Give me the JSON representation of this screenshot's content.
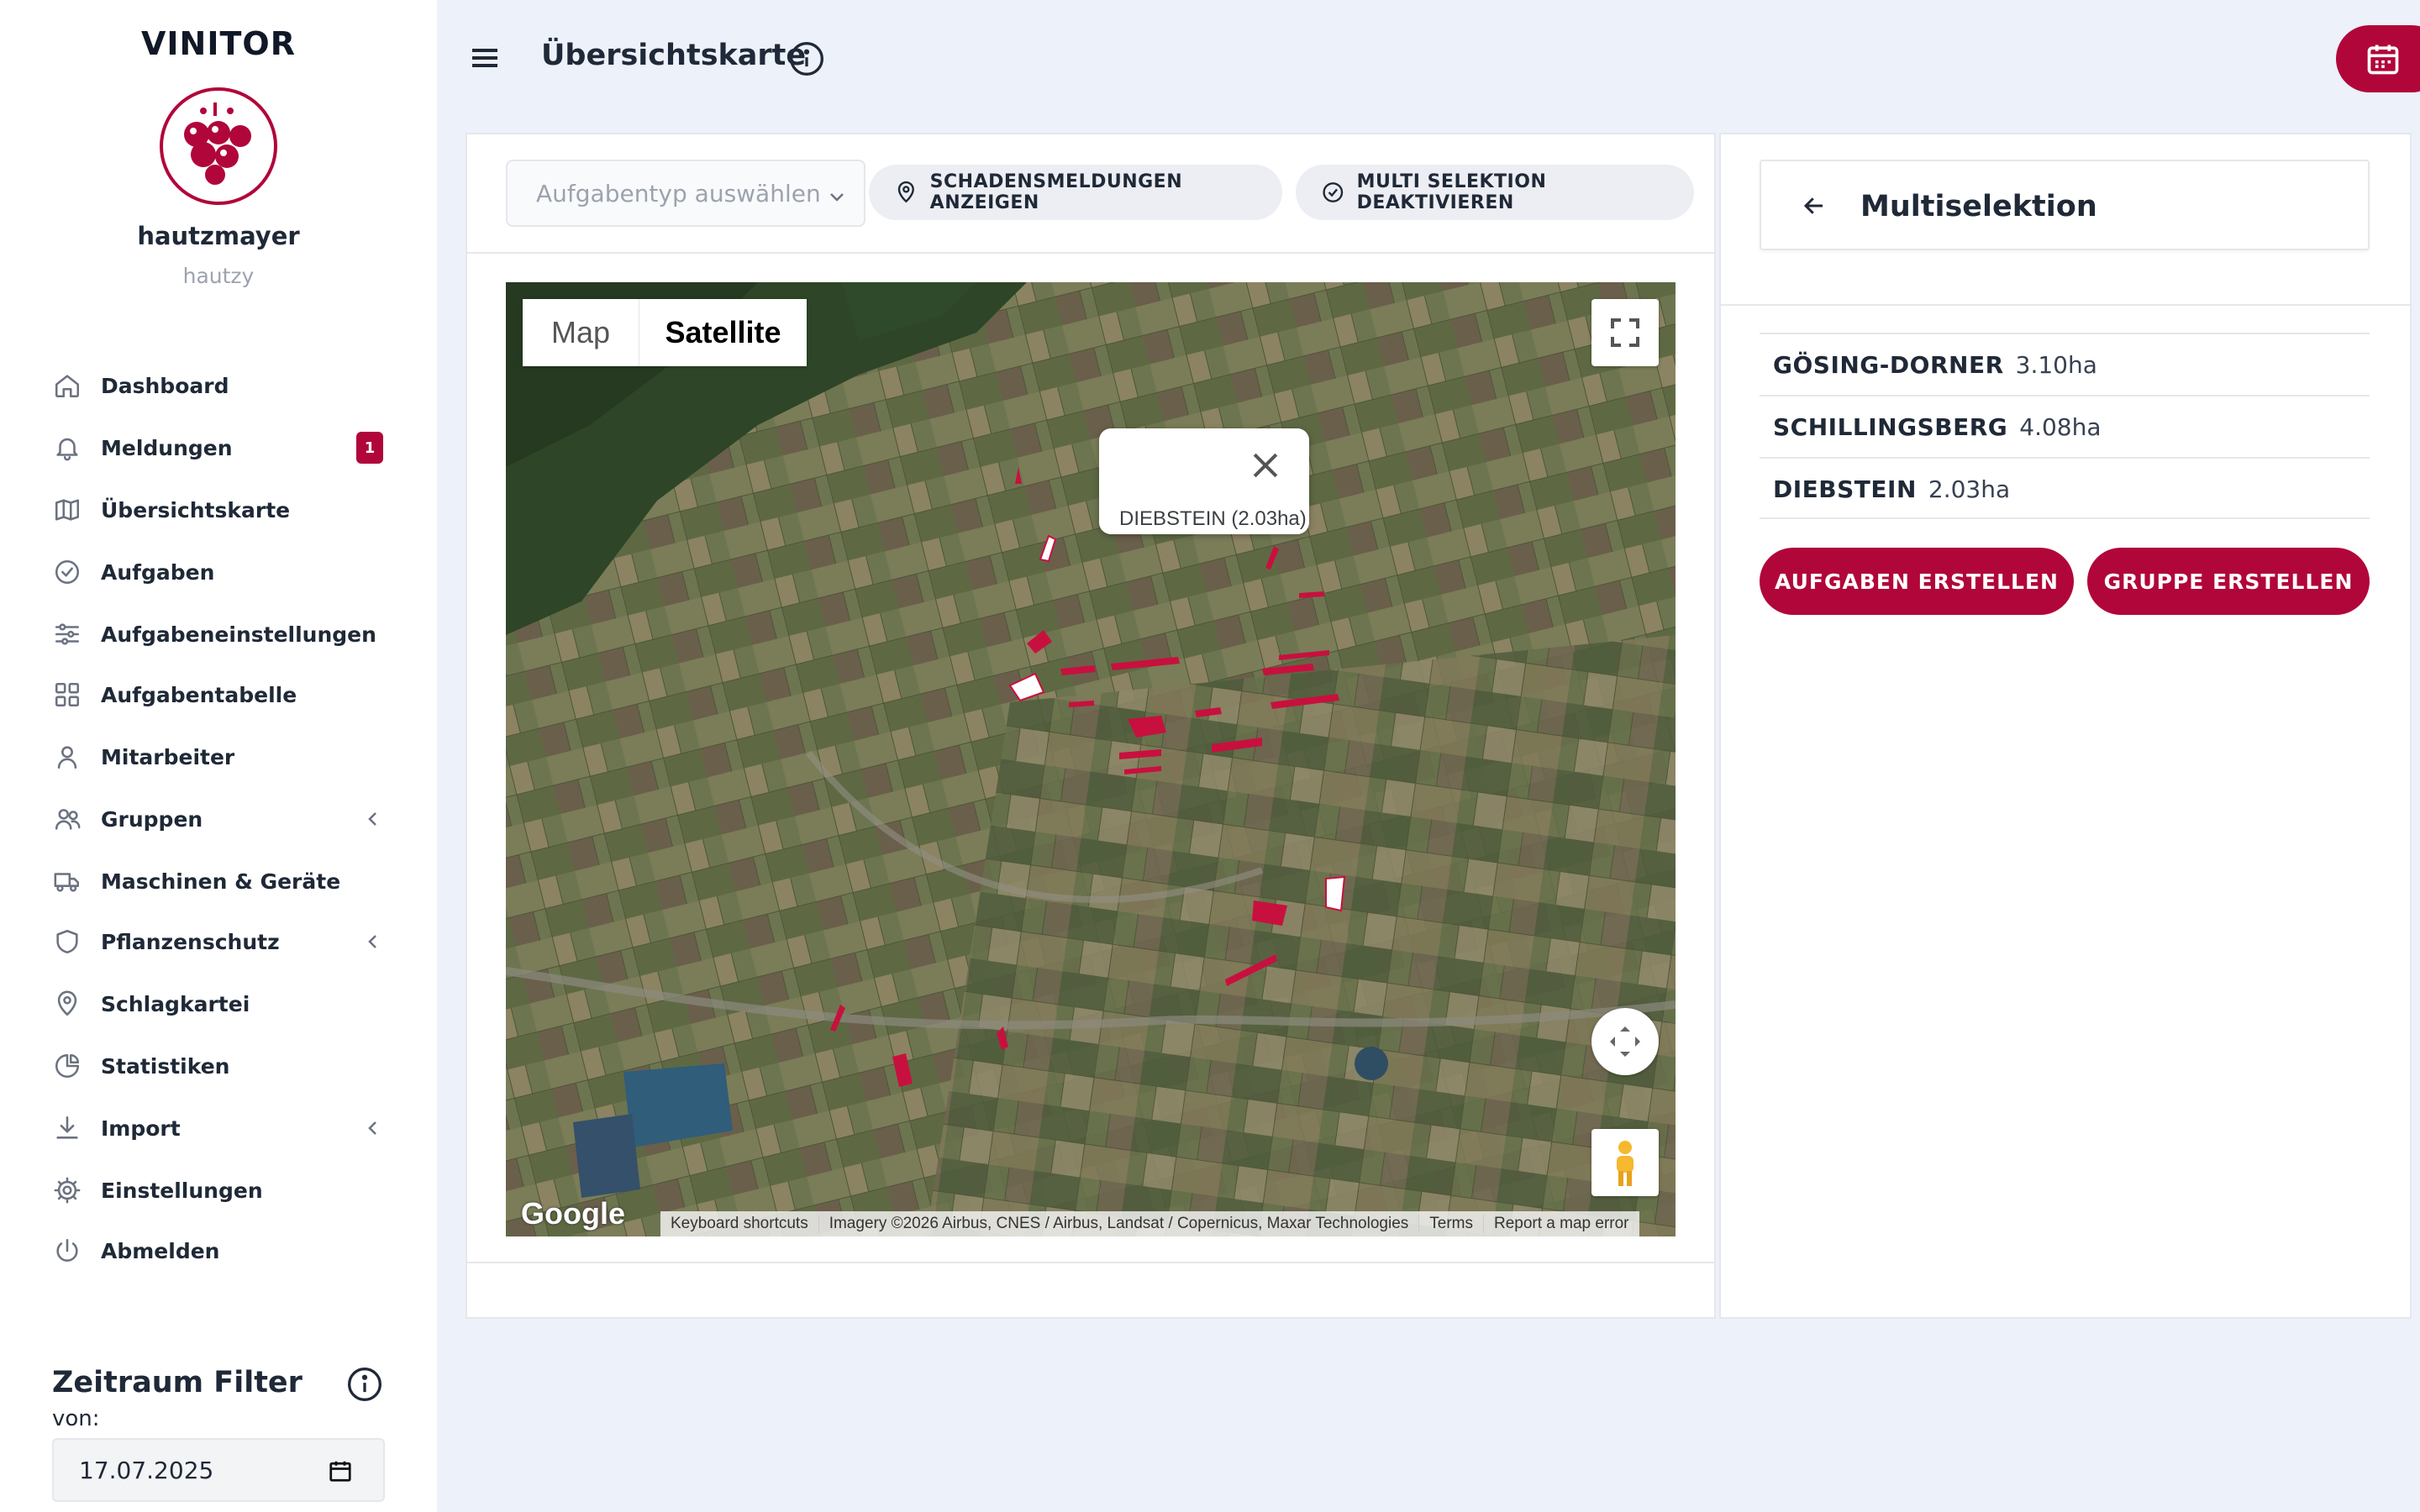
{
  "sidebar": {
    "brand": "VINITOR",
    "username": "hautzmayer",
    "userhandle": "hautzy",
    "items": [
      {
        "label": "Dashboard",
        "icon": "home-icon"
      },
      {
        "label": "Meldungen",
        "icon": "bell-icon",
        "badge": "1"
      },
      {
        "label": "Übersichtskarte",
        "icon": "map-icon"
      },
      {
        "label": "Aufgaben",
        "icon": "check-circle-icon"
      },
      {
        "label": "Aufgabeneinstellungen",
        "icon": "sliders-icon"
      },
      {
        "label": "Aufgabentabelle",
        "icon": "grid-icon"
      },
      {
        "label": "Mitarbeiter",
        "icon": "user-icon"
      },
      {
        "label": "Gruppen",
        "icon": "users-icon",
        "expandable": true
      },
      {
        "label": "Maschinen & Geräte",
        "icon": "truck-icon"
      },
      {
        "label": "Pflanzenschutz",
        "icon": "shield-icon",
        "expandable": true
      },
      {
        "label": "Schlagkartei",
        "icon": "map-pin-icon"
      },
      {
        "label": "Statistiken",
        "icon": "pie-chart-icon"
      },
      {
        "label": "Import",
        "icon": "download-icon",
        "expandable": true
      },
      {
        "label": "Einstellungen",
        "icon": "gear-icon"
      },
      {
        "label": "Abmelden",
        "icon": "power-icon"
      }
    ],
    "filter": {
      "title": "Zeitraum Filter",
      "from_label": "von:",
      "from_value": "17.07.2025"
    }
  },
  "header": {
    "title": "Übersichtskarte"
  },
  "toolbar": {
    "task_type_placeholder": "Aufgabentyp auswählen",
    "damage_button": "SCHADENSMELDUNGEN ANZEIGEN",
    "multi_button": "MULTI SELEKTION DEAKTIVIEREN"
  },
  "map": {
    "tab_map": "Map",
    "tab_satellite": "Satellite",
    "active_tab": "Satellite",
    "popup_text": "DIEBSTEIN (2.03ha)",
    "google_logo": "Google",
    "attribution": {
      "shortcuts": "Keyboard shortcuts",
      "imagery": "Imagery ©2026 Airbus, CNES / Airbus, Landsat / Copernicus, Maxar Technologies",
      "terms": "Terms",
      "report": "Report a map error"
    },
    "colors": {
      "selected_field": "#c8103e",
      "active_field": "#ffffff"
    }
  },
  "multiselect": {
    "title": "Multiselektion",
    "fields": [
      {
        "name": "GÖSING-DORNER",
        "area": "3.10ha"
      },
      {
        "name": "SCHILLINGSBERG",
        "area": "4.08ha"
      },
      {
        "name": "DIEBSTEIN",
        "area": "2.03ha"
      }
    ],
    "create_tasks": "AUFGABEN ERSTELLEN",
    "create_group": "GRUPPE ERSTELLEN"
  },
  "theme": {
    "accent": "#b1063a",
    "background": "#edf1f9"
  }
}
